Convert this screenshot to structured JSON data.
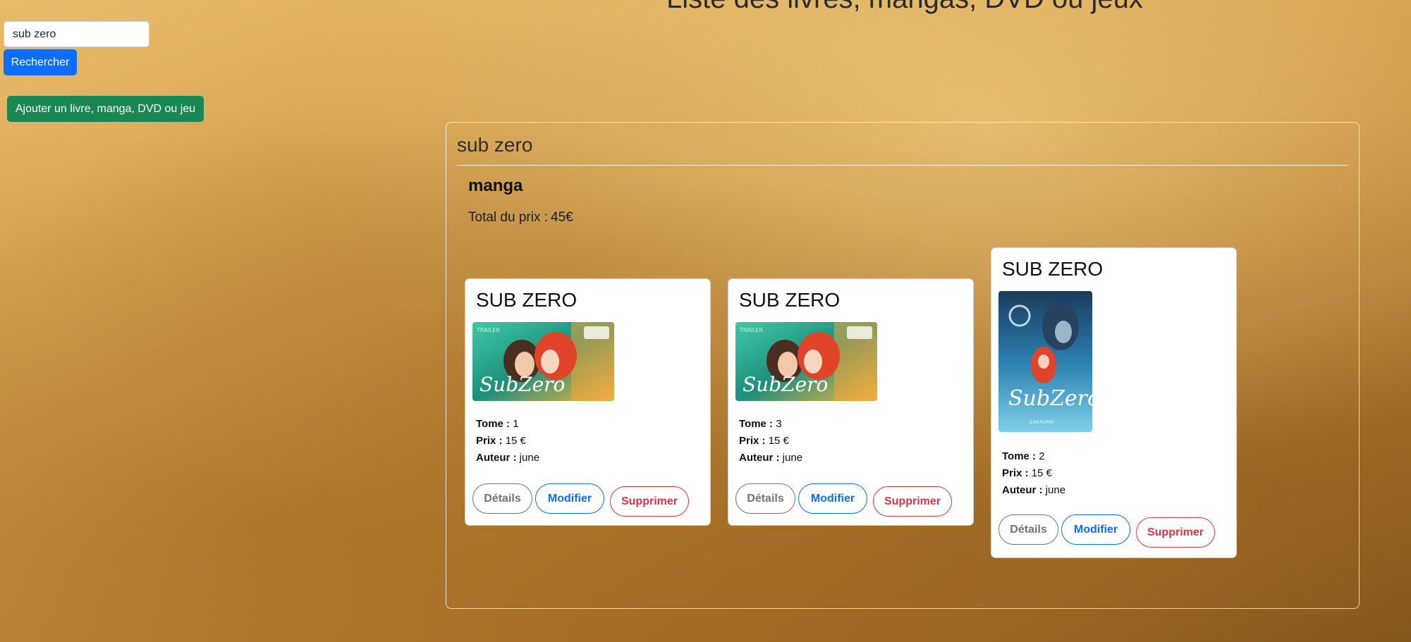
{
  "page": {
    "title": "Liste des livres, mangas, DVD ou jeux"
  },
  "search": {
    "value": "sub zero",
    "button_label": "Rechercher"
  },
  "actions": {
    "add_label": "Ajouter un livre, manga, DVD ou jeu"
  },
  "results": {
    "search_term": "sub zero",
    "category": "manga",
    "total_label": "Total du prix :",
    "total_value": "45€",
    "items": [
      {
        "title": "SUB ZERO",
        "cover": "sub-zero-banner-art",
        "tome_label": "Tome :",
        "tome": "1",
        "prix_label": "Prix :",
        "prix": "15 €",
        "auteur_label": "Auteur :",
        "auteur": "june",
        "details_label": "Détails",
        "modifier_label": "Modifier",
        "supprimer_label": "Supprimer"
      },
      {
        "title": "SUB ZERO",
        "cover": "sub-zero-banner-art",
        "tome_label": "Tome :",
        "tome": "3",
        "prix_label": "Prix :",
        "prix": "15 €",
        "auteur_label": "Auteur :",
        "auteur": "june",
        "details_label": "Détails",
        "modifier_label": "Modifier",
        "supprimer_label": "Supprimer"
      },
      {
        "title": "SUB ZERO",
        "cover": "sub-zero-book-cover",
        "tome_label": "Tome :",
        "tome": "2",
        "prix_label": "Prix :",
        "prix": "15 €",
        "auteur_label": "Auteur :",
        "auteur": "june",
        "details_label": "Détails",
        "modifier_label": "Modifier",
        "supprimer_label": "Supprimer"
      }
    ]
  }
}
